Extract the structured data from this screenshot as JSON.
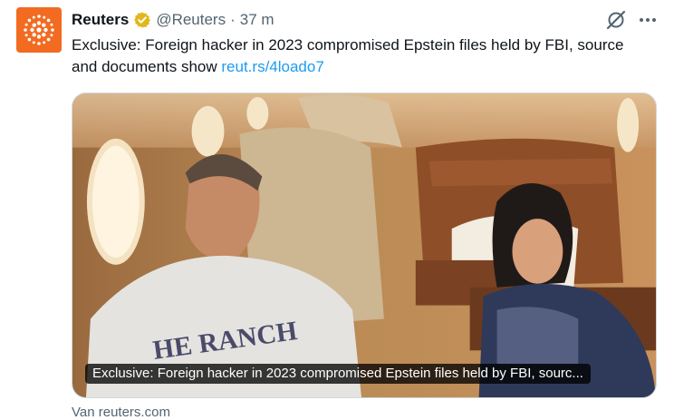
{
  "tweet": {
    "account_name": "Reuters",
    "handle": "@Reuters",
    "separator": "·",
    "time": "37 m",
    "text": "Exclusive: Foreign hacker in 2023 compromised Epstein files held by FBI, source and documents show",
    "link": "reut.rs/4loado7"
  },
  "card": {
    "caption": "Exclusive: Foreign hacker in 2023 compromised Epstein files held by FBI, sourc...",
    "shirt_text": "HE RANCH",
    "source": "Van reuters.com"
  },
  "icons": {
    "avatar": "reuters-logo-icon",
    "verified": "verified-badge-icon",
    "grok": "grok-icon",
    "more": "more-icon"
  },
  "colors": {
    "brand_orange": "#f26b21",
    "verified_gold": "#e2b719",
    "link_blue": "#1d9bf0",
    "secondary_text": "#536471"
  }
}
